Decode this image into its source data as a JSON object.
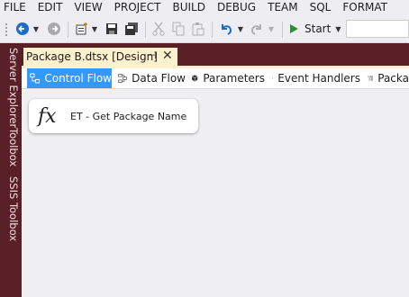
{
  "menu": [
    "FILE",
    "EDIT",
    "VIEW",
    "PROJECT",
    "BUILD",
    "DEBUG",
    "TEAM",
    "SQL",
    "FORMAT"
  ],
  "toolbar": {
    "start_label": "Start"
  },
  "side_tabs": [
    "Server Explorer",
    "Toolbox",
    "SSIS Toolbox"
  ],
  "document_tab": {
    "title": "Package B.dtsx [Design]"
  },
  "designer_tabs": [
    "Control Flow",
    "Data Flow",
    "Parameters",
    "Event Handlers",
    "Packa"
  ],
  "task": {
    "label": "ET - Get Package Name",
    "icon_text": "fx"
  },
  "colors": {
    "accent": "#3399ff",
    "chrome": "#5a2028",
    "tab": "#fdf0cc"
  }
}
